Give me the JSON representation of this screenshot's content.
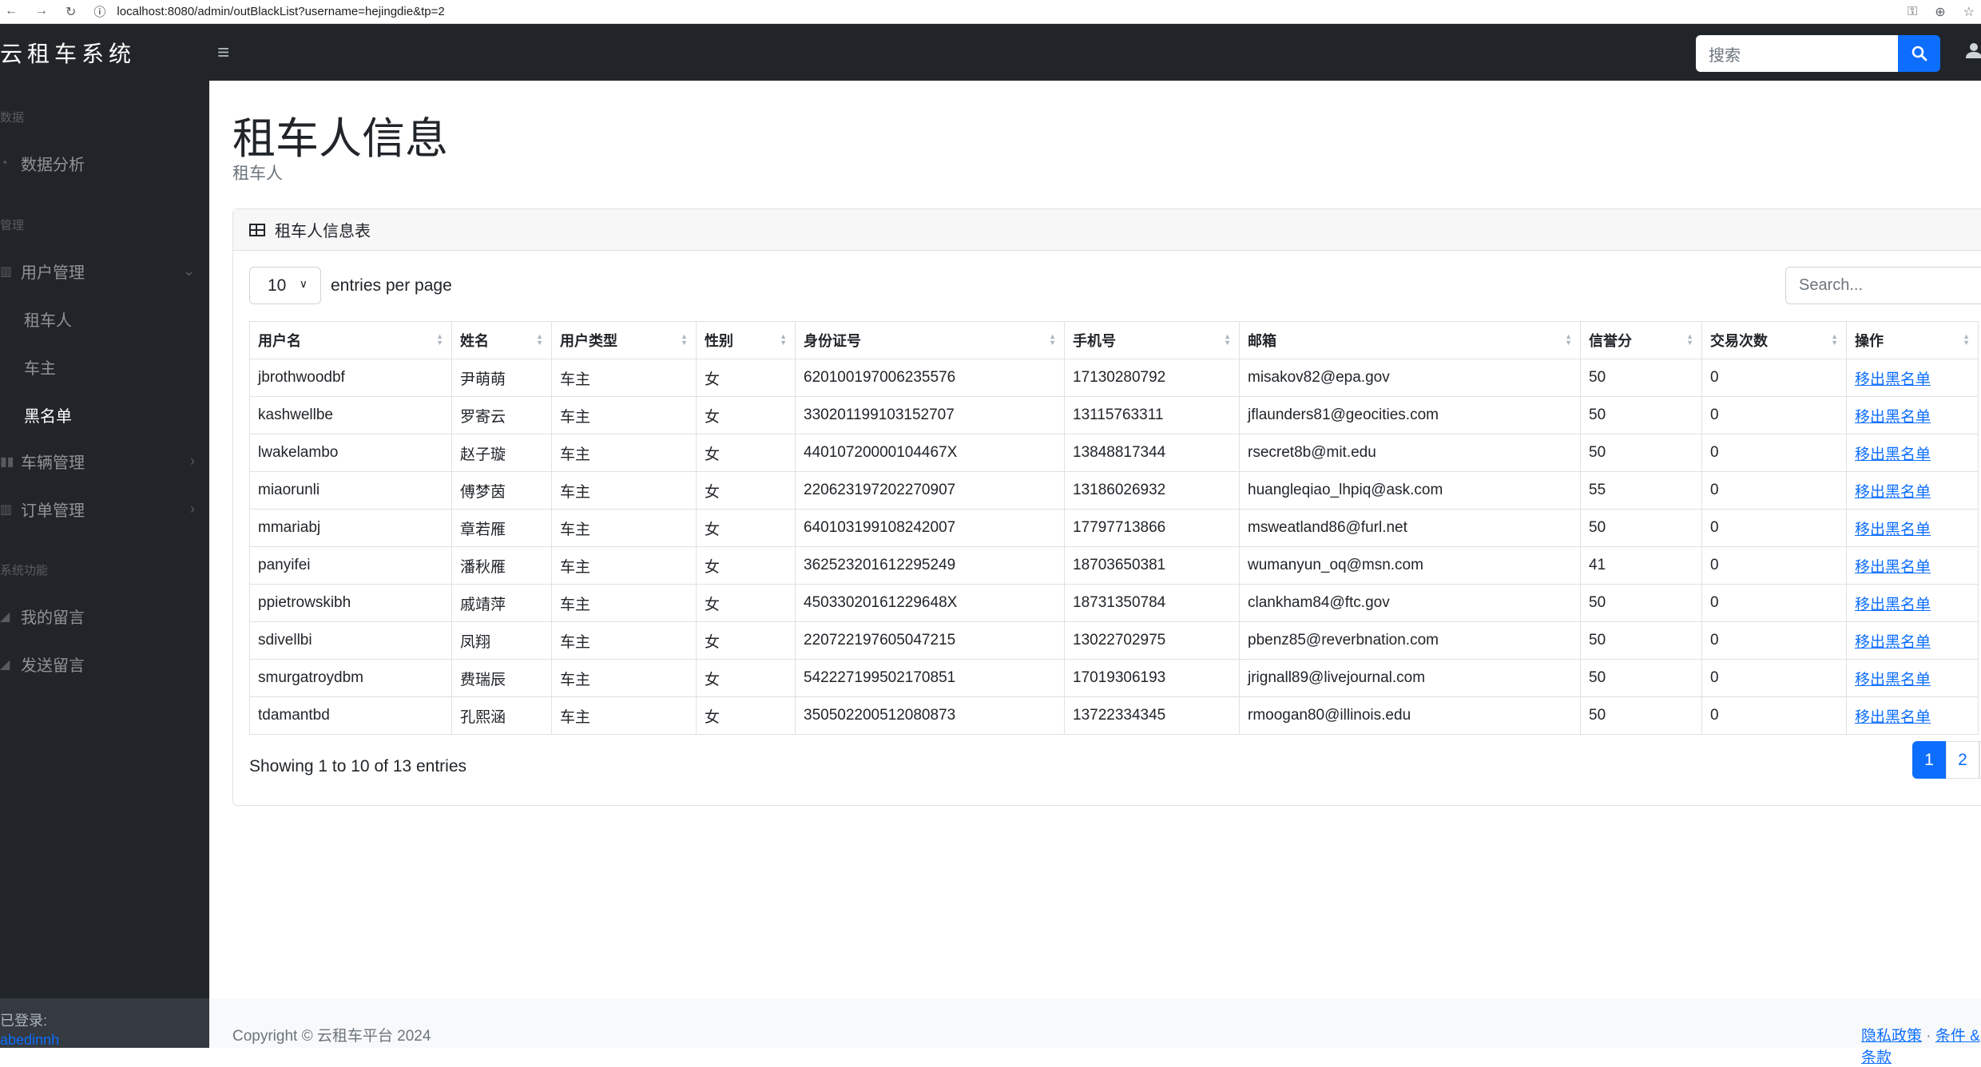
{
  "browser": {
    "url": "localhost:8080/admin/outBlackList?username=hejingdie&tp=2"
  },
  "topnav": {
    "brand": "云租车系统",
    "search_placeholder": "搜索"
  },
  "sidebar": {
    "heading_data": "数据",
    "item_analysis": "数据分析",
    "heading_manage": "管理",
    "item_user_mgmt": "用户管理",
    "sub_renter": "租车人",
    "sub_owner": "车主",
    "sub_blacklist": "黑名单",
    "item_vehicle_mgmt": "车辆管理",
    "item_order_mgmt": "订单管理",
    "heading_system": "系统功能",
    "item_my_messages": "我的留言",
    "item_send_message": "发送留言",
    "footer_logged_in": "已登录:",
    "footer_username": "abedinnh"
  },
  "main": {
    "title": "租车人信息",
    "subtitle": "租车人",
    "card_title": "租车人信息表",
    "per_page_value": "10",
    "per_page_label": "entries per page",
    "table_search_placeholder": "Search...",
    "columns": [
      "用户名",
      "姓名",
      "用户类型",
      "性别",
      "身份证号",
      "手机号",
      "邮箱",
      "信誉分",
      "交易次数",
      "操作"
    ],
    "rows": [
      [
        "jbrothwoodbf",
        "尹萌萌",
        "车主",
        "女",
        "620100197006235576",
        "17130280792",
        "misakov82@epa.gov",
        "50",
        "0",
        "移出黑名单"
      ],
      [
        "kashwellbe",
        "罗寄云",
        "车主",
        "女",
        "330201199103152707",
        "13115763311",
        "jflaunders81@geocities.com",
        "50",
        "0",
        "移出黑名单"
      ],
      [
        "lwakelambo",
        "赵子璇",
        "车主",
        "女",
        "44010720000104467X",
        "13848817344",
        "rsecret8b@mit.edu",
        "50",
        "0",
        "移出黑名单"
      ],
      [
        "miaorunli",
        "傅梦茵",
        "车主",
        "女",
        "220623197202270907",
        "13186026932",
        "huangleqiao_lhpiq@ask.com",
        "55",
        "0",
        "移出黑名单"
      ],
      [
        "mmariabj",
        "章若雁",
        "车主",
        "女",
        "640103199108242007",
        "17797713866",
        "msweatland86@furl.net",
        "50",
        "0",
        "移出黑名单"
      ],
      [
        "panyifei",
        "潘秋雁",
        "车主",
        "女",
        "362523201612295249",
        "18703650381",
        "wumanyun_oq@msn.com",
        "41",
        "0",
        "移出黑名单"
      ],
      [
        "ppietrowskibh",
        "戚靖萍",
        "车主",
        "女",
        "45033020161229648X",
        "18731350784",
        "clankham84@ftc.gov",
        "50",
        "0",
        "移出黑名单"
      ],
      [
        "sdivellbi",
        "凤翔",
        "车主",
        "女",
        "220722197605047215",
        "13022702975",
        "pbenz85@reverbnation.com",
        "50",
        "0",
        "移出黑名单"
      ],
      [
        "smurgatroydbm",
        "费瑞辰",
        "车主",
        "女",
        "542227199502170851",
        "17019306193",
        "jrignall89@livejournal.com",
        "50",
        "0",
        "移出黑名单"
      ],
      [
        "tdamantbd",
        "孔熙涵",
        "车主",
        "女",
        "350502200512080873",
        "13722334345",
        "rmoogan80@illinois.edu",
        "50",
        "0",
        "移出黑名单"
      ]
    ],
    "showing_text": "Showing 1 to 10 of 13 entries",
    "pages": [
      "1",
      "2",
      "›"
    ]
  },
  "footer": {
    "copyright": "Copyright © 云租车平台 2024",
    "privacy": "隐私政策",
    "sep": " · ",
    "terms": "条件 & 条款"
  }
}
